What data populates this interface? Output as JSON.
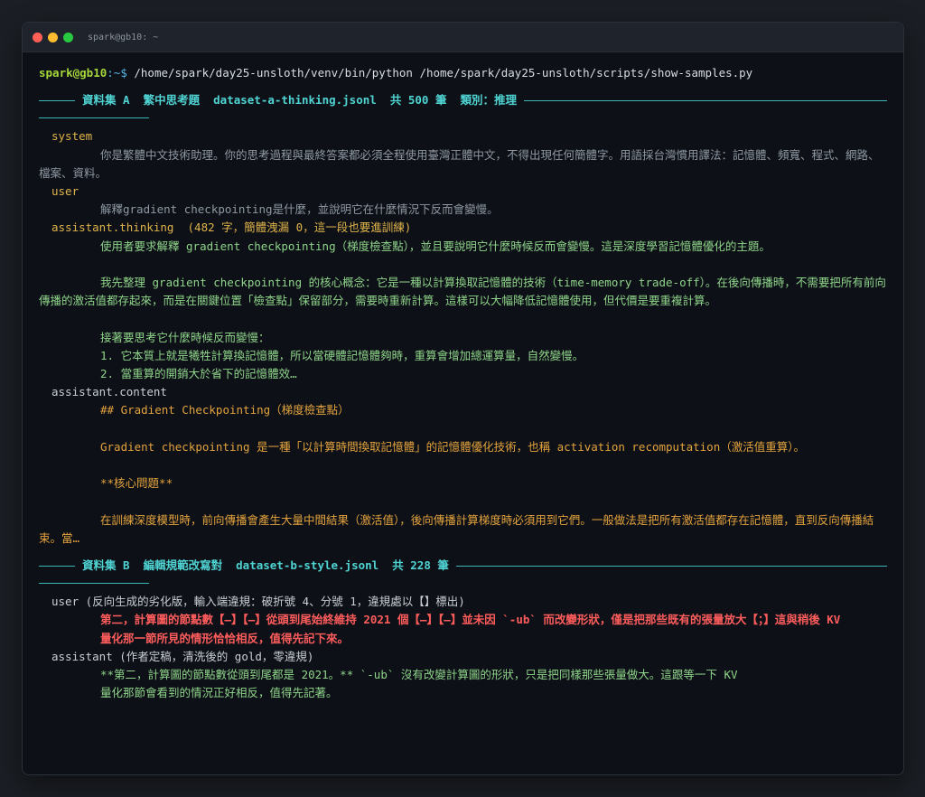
{
  "window": {
    "title": "spark@gb10: ~"
  },
  "prompt": {
    "user": "spark@gb10",
    "path": ":~$ ",
    "command": "/home/spark/day25-unsloth/venv/bin/python /home/spark/day25-unsloth/scripts/show-samples.py"
  },
  "datasetA": {
    "header": "資料集 A  繁中思考題  dataset-a-thinking.jsonl  共 500 筆  類別：推理",
    "system_role": "system",
    "system_text": "你是繁體中文技術助理。你的思考過程與最終答案都必須全程使用臺灣正體中文，不得出現任何簡體字。用語採台灣慣用譯法：記憶體、頻寬、程式、網路、檔案、資料。",
    "user_role": "user",
    "user_text": "解釋gradient checkpointing是什麼，並說明它在什麼情況下反而會變慢。",
    "thinking_role": "assistant.thinking  (482 字，簡體洩漏 0，這一段也要進訓練)",
    "thinking_p1": "使用者要求解釋 gradient checkpointing（梯度檢查點），並且要說明它什麼時候反而會變慢。這是深度學習記憶體優化的主題。",
    "thinking_p2": "我先整理 gradient checkpointing 的核心概念：它是一種以計算換取記憶體的技術（time-memory trade-off）。在後向傳播時，不需要把所有前向傳播的激活值都存起來，而是在關鍵位置「檢查點」保留部分，需要時重新計算。這樣可以大幅降低記憶體使用，但代價是要重複計算。",
    "thinking_p3a": "接著要思考它什麼時候反而變慢：",
    "thinking_p3b": "1. 它本質上就是犧牲計算換記憶體，所以當硬體記憶體夠時，重算會增加總運算量，自然變慢。",
    "thinking_p3c": "2. 當重算的開銷大於省下的記憶體效…",
    "content_role": "assistant.content",
    "content_h": "## Gradient Checkpointing（梯度檢查點）",
    "content_p1": "Gradient checkpointing 是一種「以計算時間換取記憶體」的記憶體優化技術，也稱 activation recomputation（激活值重算）。",
    "content_bold": "**核心問題**",
    "content_p2": "在訓練深度模型時，前向傳播會產生大量中間結果（激活值），後向傳播計算梯度時必須用到它們。一般做法是把所有激活值都存在記憶體，直到反向傳播結束。當…"
  },
  "datasetB": {
    "header": "資料集 B  編輯規範改寫對  dataset-b-style.jsonl  共 228 筆",
    "user_role": "user (反向生成的劣化版，輸入端違規：破折號 4、分號 1，違規處以【】標出)",
    "user_text1": "第二，計算圖的節點數【—】【—】從頭到尾始終維持 2021 個【—】【—】並未因 `-ub` 而改變形狀，僅是把那些既有的張量放大【；】這與稍後 KV",
    "user_text2": "量化那一節所見的情形恰恰相反，值得先記下來。",
    "assistant_role": "assistant (作者定稿，清洗後的 gold，零違規)",
    "assistant_text1": "**第二，計算圖的節點數從頭到尾都是 2021。** `-ub` 沒有改變計算圖的形狀，只是把同樣那些張量做大。這跟等一下 KV",
    "assistant_text2": "量化那節會看到的情況正好相反，值得先記著。"
  }
}
